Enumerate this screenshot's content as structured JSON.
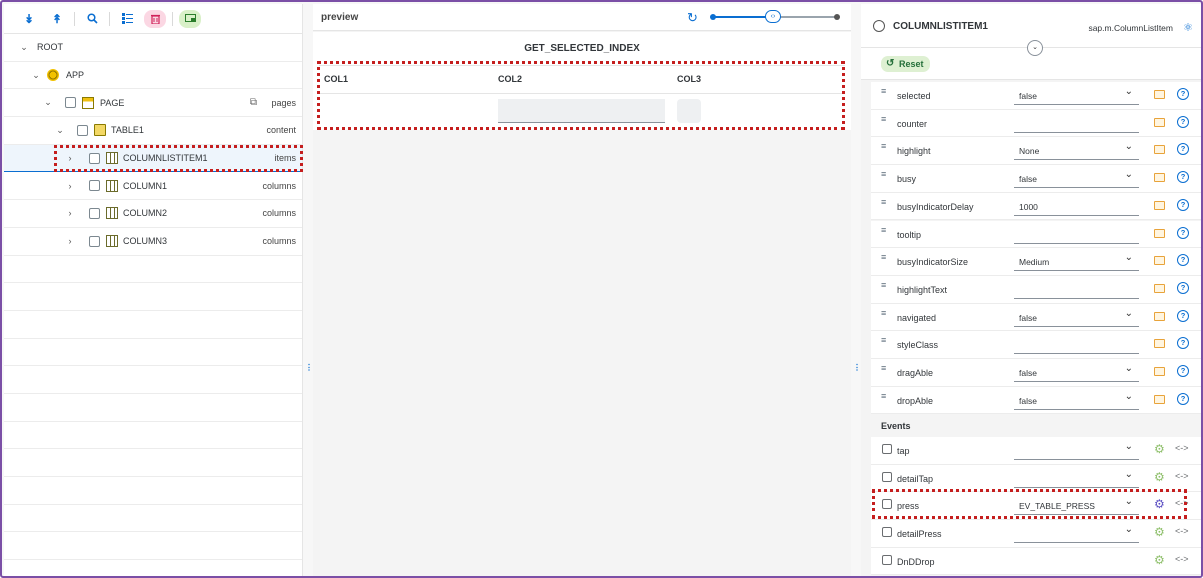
{
  "tree": {
    "toolbar": [
      {
        "name": "expand-all-button",
        "glyph": "»"
      },
      {
        "name": "collapse-all-button",
        "glyph": "«"
      },
      {
        "name": "search-button",
        "glyph": "⚲"
      },
      {
        "name": "tree-view-button",
        "glyph": "☰"
      },
      {
        "name": "delete-button",
        "glyph": "␡"
      },
      {
        "name": "preview-button",
        "glyph": "▭"
      }
    ],
    "nodes": [
      {
        "label": "ROOT",
        "aggregation": ""
      },
      {
        "label": "APP",
        "aggregation": ""
      },
      {
        "label": "PAGE",
        "aggregation": "pages"
      },
      {
        "label": "TABLE1",
        "aggregation": "content"
      },
      {
        "label": "COLUMNLISTITEM1",
        "aggregation": "items"
      },
      {
        "label": "COLUMN1",
        "aggregation": "columns"
      },
      {
        "label": "COLUMN2",
        "aggregation": "columns"
      },
      {
        "label": "COLUMN3",
        "aggregation": "columns"
      }
    ]
  },
  "preview": {
    "title": "preview",
    "heading": "GET_SELECTED_INDEX",
    "columns": [
      "COL1",
      "COL2",
      "COL3"
    ]
  },
  "properties": {
    "control_name": "COLUMNLISTITEM1",
    "control_class": "sap.m.ColumnListItem",
    "reset_label": "Reset",
    "rows": [
      {
        "name": "selected",
        "value": "false",
        "dropdown": true
      },
      {
        "name": "counter",
        "value": "",
        "dropdown": false
      },
      {
        "name": "highlight",
        "value": "None",
        "dropdown": true
      },
      {
        "name": "busy",
        "value": "false",
        "dropdown": true
      },
      {
        "name": "busyIndicatorDelay",
        "value": "1000",
        "dropdown": false
      },
      {
        "name": "tooltip",
        "value": "",
        "dropdown": false
      },
      {
        "name": "busyIndicatorSize",
        "value": "Medium",
        "dropdown": true
      },
      {
        "name": "highlightText",
        "value": "",
        "dropdown": false
      },
      {
        "name": "navigated",
        "value": "false",
        "dropdown": true
      },
      {
        "name": "styleClass",
        "value": "",
        "dropdown": false
      },
      {
        "name": "dragAble",
        "value": "false",
        "dropdown": true
      },
      {
        "name": "dropAble",
        "value": "false",
        "dropdown": true
      }
    ],
    "events_label": "Events",
    "events": [
      {
        "name": "tap",
        "value": ""
      },
      {
        "name": "detailTap",
        "value": ""
      },
      {
        "name": "press",
        "value": "EV_TABLE_PRESS"
      },
      {
        "name": "detailPress",
        "value": ""
      },
      {
        "name": "DnDDrop",
        "value": ""
      }
    ]
  }
}
